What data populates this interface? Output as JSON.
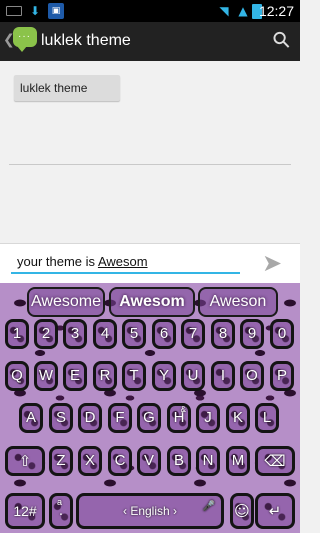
{
  "status_bar": {
    "time": "12:27",
    "icons": [
      "keyboard-icon",
      "download-icon",
      "app-notification-icon",
      "wifi-icon",
      "signal-icon",
      "battery-icon"
    ]
  },
  "action_bar": {
    "title": "luklek theme",
    "back_glyph": "❮",
    "attach_glyph": "📎"
  },
  "conversation": {
    "recipient_chip": "luklek theme"
  },
  "compose": {
    "prefix": "your theme is ",
    "current_word": "Awesom"
  },
  "keyboard": {
    "suggestions": [
      "Awesome",
      "Awesom",
      "Aweson"
    ],
    "number_row": [
      "1",
      "2",
      "3",
      "4",
      "5",
      "6",
      "7",
      "8",
      "9",
      "0"
    ],
    "row_q": [
      "Q",
      "W",
      "E",
      "R",
      "T",
      "Y",
      "U",
      "I",
      "O",
      "P"
    ],
    "row_a": [
      "A",
      "S",
      "D",
      "F",
      "G",
      "H",
      "J",
      "K",
      "L"
    ],
    "row_z": [
      "Z",
      "X",
      "C",
      "V",
      "B",
      "N",
      "M"
    ],
    "alt_row_a": [
      "",
      "",
      "",
      "",
      "",
      "&",
      "",
      "",
      ""
    ],
    "alt_row_z": [
      "",
      "",
      "",
      "",
      "",
      "",
      "",
      ""
    ],
    "mode_key": "12#",
    "punct_key": ".",
    "punct_alt": "a",
    "space_label": "‹ English ›",
    "colors": {
      "accent": "#33b5e5",
      "key_fill": "#9565ad",
      "key_border": "#141414"
    }
  }
}
